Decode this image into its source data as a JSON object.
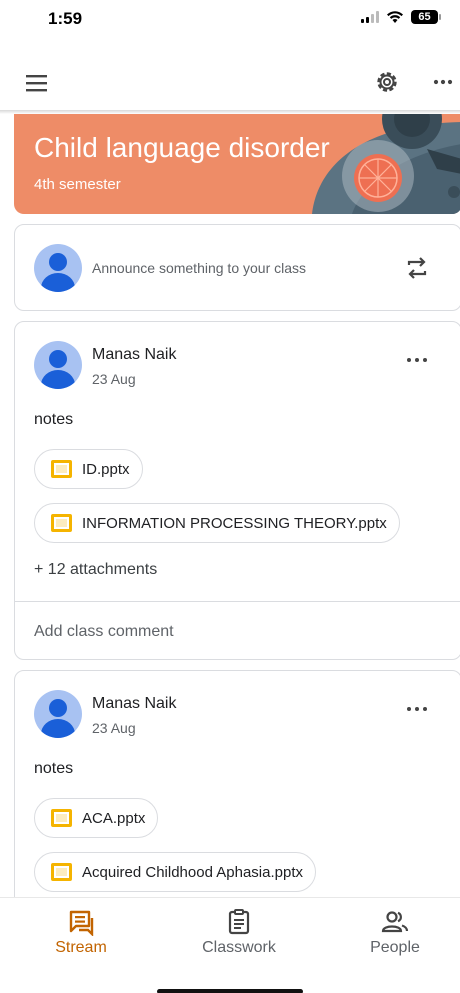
{
  "status_bar": {
    "time": "1:59",
    "battery": "65"
  },
  "course": {
    "title": "Child language disorder",
    "subtitle": "4th semester"
  },
  "announce": {
    "placeholder": "Announce something to your class"
  },
  "posts": [
    {
      "author": "Manas Naik",
      "date": "23 Aug",
      "body": "notes",
      "attachments": [
        "ID.pptx",
        "INFORMATION PROCESSING THEORY.pptx"
      ],
      "more_attachments": "+ 12 attachments",
      "comment_placeholder": "Add class comment"
    },
    {
      "author": "Manas Naik",
      "date": "23 Aug",
      "body": "notes",
      "attachments": [
        "ACA.pptx",
        "Acquired Childhood Aphasia.pptx"
      ]
    }
  ],
  "nav": {
    "items": [
      {
        "label": "Stream",
        "icon": "stream-icon",
        "active": true
      },
      {
        "label": "Classwork",
        "icon": "classwork-icon",
        "active": false
      },
      {
        "label": "People",
        "icon": "people-icon",
        "active": false
      }
    ]
  },
  "colors": {
    "accent": "#c26401",
    "banner": "#ee8c67",
    "file_icon": "#f5b400",
    "avatar_bg": "#a8c2f2",
    "avatar_fg": "#1a5fd8"
  },
  "icons": [
    "menu-icon",
    "settings-gear-icon",
    "more-options-icon",
    "repost-icon",
    "pptx-file-icon"
  ]
}
